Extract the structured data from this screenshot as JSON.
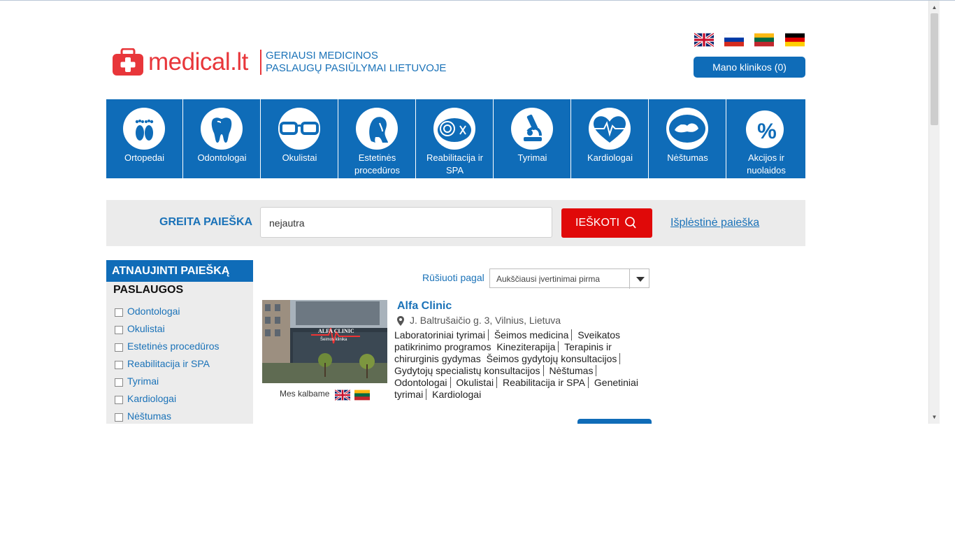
{
  "header": {
    "brand": "medical.lt",
    "tagline_line1": "GERIAUSI MEDICINOS",
    "tagline_line2": "PASLAUGŲ PASIŪLYMAI LIETUVOJE",
    "my_clinics_button": "Mano klinikos (0)",
    "languages": [
      "en-flag-icon",
      "ru-flag-icon",
      "lt-flag-icon",
      "de-flag-icon"
    ]
  },
  "categories": [
    {
      "label": "Ortopedai",
      "icon": "feet-icon"
    },
    {
      "label": "Odontologai",
      "icon": "tooth-icon"
    },
    {
      "label": "Okulistai",
      "icon": "glasses-icon"
    },
    {
      "label": "Estetinės procedūros",
      "icon": "woman-profile-icon"
    },
    {
      "label": "Reabilitacija ir SPA",
      "icon": "spa-towel-icon"
    },
    {
      "label": "Tyrimai",
      "icon": "microscope-icon"
    },
    {
      "label": "Kardiologai",
      "icon": "heart-pulse-icon"
    },
    {
      "label": "Nėštumas",
      "icon": "baby-icon"
    },
    {
      "label": "Akcijos ir nuolaidos",
      "icon": "percent-icon"
    }
  ],
  "search": {
    "title": "GREITA PAIEŠKA",
    "query": "nejautra",
    "button": "IEŠKOTI",
    "advanced_link": "Išplėstinė paieška"
  },
  "sidebar": {
    "header": "ATNAUJINTI PAIEŠKĄ",
    "subheader": "PASLAUGOS",
    "items": [
      "Odontologai",
      "Okulistai",
      "Estetinės procedūros",
      "Reabilitacija ir SPA",
      "Tyrimai",
      "Kardiologai",
      "Nėštumas"
    ]
  },
  "sort": {
    "label": "Rūšiuoti pagal",
    "selected": "Aukščiausi įvertinimai pirma"
  },
  "result": {
    "name": "Alfa Clinic",
    "address": "J. Baltrušaičio g. 3, Vilnius, Lietuva",
    "we_speak": "Mes kalbame",
    "photo_sign_line1": "ALFA CLINIC",
    "photo_sign_line2": "Šeimos klinika",
    "services": [
      "Laboratoriniai tyrimai",
      "Šeimos medicina",
      "Sveikatos patikrinimo programos",
      "Kineziterapija",
      "Terapinis ir chirurginis gydymas",
      "Šeimos gydytojų konsultacijos",
      "Gydytojų specialistų konsultacijos",
      "Nėštumas",
      "Odontologai",
      "Okulistai",
      "Reabilitacija ir SPA",
      "Genetiniai tyrimai",
      "Kardiologai"
    ]
  },
  "colors": {
    "brand_red": "#e8363a",
    "brand_blue": "#0f6cb8",
    "link_blue": "#1a72b8",
    "search_red": "#e00909"
  }
}
